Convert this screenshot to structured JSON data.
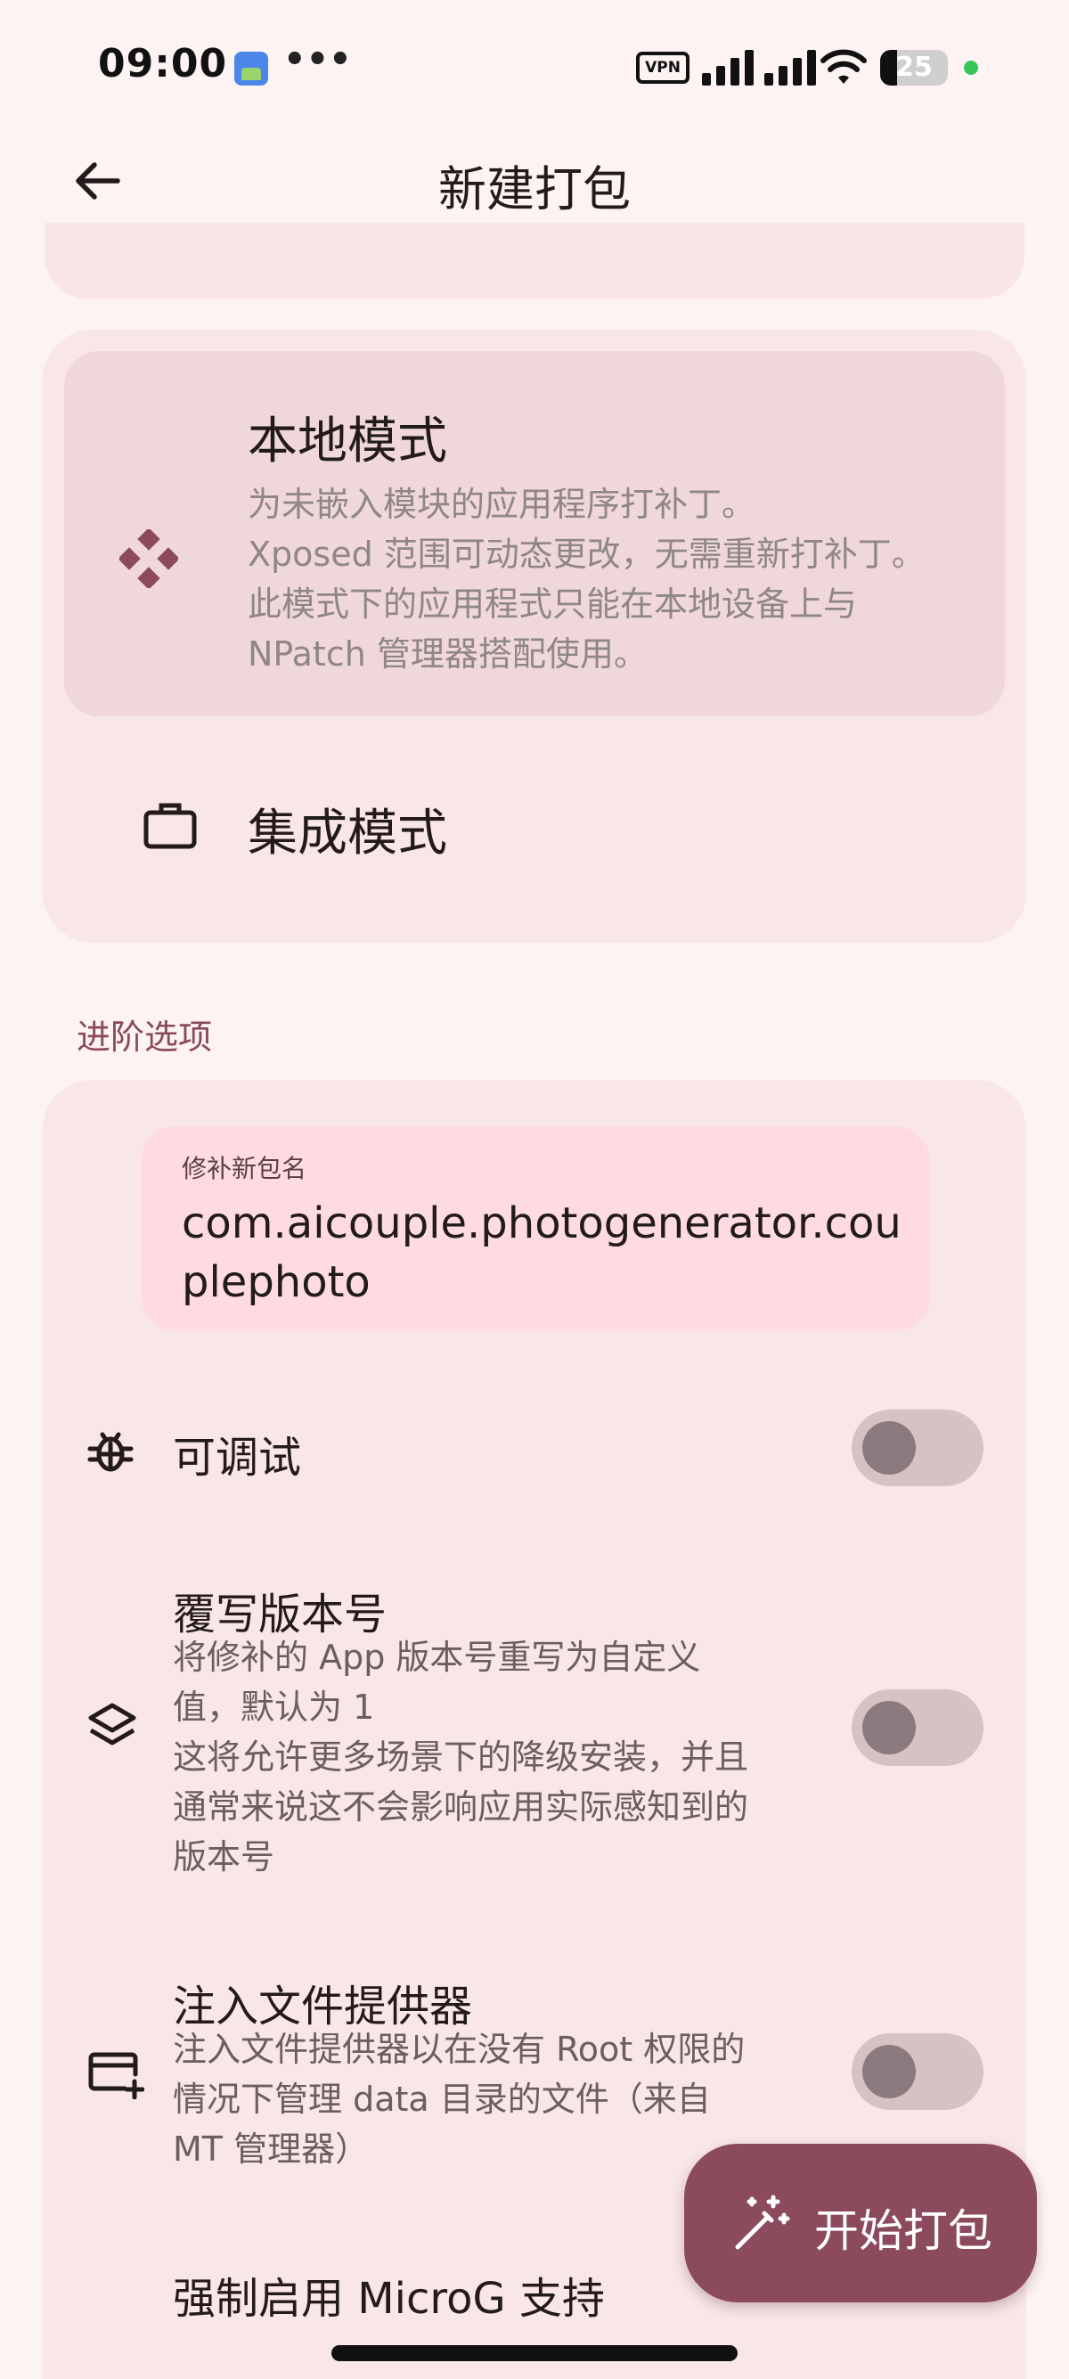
{
  "status_bar": {
    "time": "09:00",
    "more": "•••",
    "vpn": "VPN",
    "battery_level": "25",
    "battery_fraction": 0.25,
    "charging_dot_color": "#35c759"
  },
  "app_bar": {
    "back_icon": "arrow-left-icon",
    "title": "新建打包"
  },
  "patch_modes": {
    "local": {
      "icon": "diamond-dots-icon",
      "title": "本地模式",
      "description_lines": [
        "为未嵌入模块的应用程序打补丁。",
        "Xposed 范围可动态更改，无需重新打补丁。",
        "此模式下的应用程式只能在本地设备上与",
        "NPatch 管理器搭配使用。"
      ],
      "selected": true
    },
    "integrated": {
      "icon": "briefcase-icon",
      "title": "集成模式",
      "selected": false
    }
  },
  "advanced": {
    "section_title": "进阶选项",
    "package_name_field": {
      "label": "修补新包名",
      "value": "com.aicouple.photogenerator.couplephoto"
    },
    "options": [
      {
        "icon": "bug-icon",
        "title": "可调试",
        "description_lines": [],
        "enabled": false
      },
      {
        "icon": "layers-icon",
        "title": "覆写版本号",
        "description_lines": [
          "将修补的 App 版本号重写为自定义",
          "值，默认为 1",
          "这将允许更多场景下的降级安装，并且",
          "通常来说这不会影响应用实际感知到的",
          "版本号"
        ],
        "enabled": false
      },
      {
        "icon": "card-add-icon",
        "title": "注入文件提供器",
        "description_lines": [
          "注入文件提供器以在没有 Root 权限的",
          "情况下管理 data 目录的文件（来自",
          "MT 管理器）"
        ],
        "enabled": false
      },
      {
        "icon": "",
        "title": "强制启用 MicroG 支持",
        "description_lines": [],
        "enabled": false
      }
    ]
  },
  "fab": {
    "icon": "magic-wand-icon",
    "label": "开始打包"
  },
  "colors": {
    "background": "#fdf3f2",
    "card": "#f9e6e6",
    "selected_mode": "#f0d7d9",
    "field": "#fddbe1",
    "accent": "#8c4a5d",
    "switch_track_off": "#d8c1c4",
    "switch_thumb_off": "#8a7a7e"
  }
}
